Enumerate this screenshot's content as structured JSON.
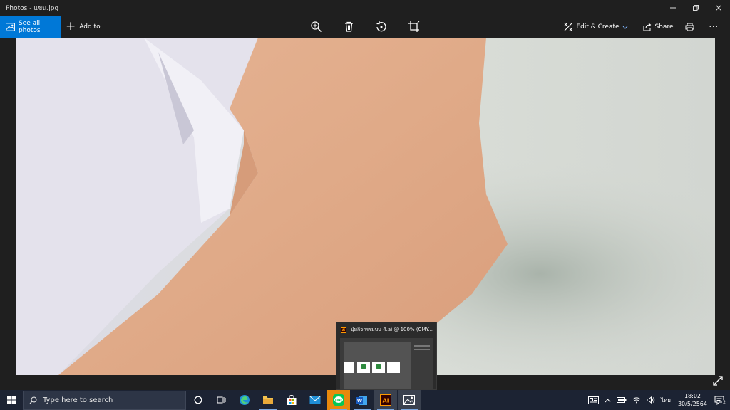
{
  "window": {
    "title": "Photos - แขน.jpg",
    "controls": [
      "minimize",
      "restore",
      "close"
    ]
  },
  "toolbar": {
    "see_all_label": "See all photos",
    "add_to_label": "Add to",
    "edit_create_label": "Edit & Create",
    "share_label": "Share",
    "more_label": "···",
    "center_icons": [
      "zoom-in-icon",
      "delete-icon",
      "rotate-icon",
      "crop-icon"
    ]
  },
  "popup": {
    "title": "ปุ่มกิจกรรมบน 4.ai @ 100% (CMY...",
    "badge": "Ai"
  },
  "taskbar": {
    "search_placeholder": "Type here to search",
    "lang": "ไทย",
    "time": "18:02",
    "date": "30/5/2564",
    "notification_count": "2",
    "apps": [
      "cortana",
      "task-view",
      "edge",
      "file-explorer",
      "store",
      "mail",
      "line",
      "word",
      "illustrator",
      "photos"
    ]
  },
  "colors": {
    "accent": "#0078d7",
    "taskbar": "#1c2333",
    "chrome": "#1f1f1f",
    "line_green": "#06c755",
    "ai_orange": "#ff9a00"
  }
}
